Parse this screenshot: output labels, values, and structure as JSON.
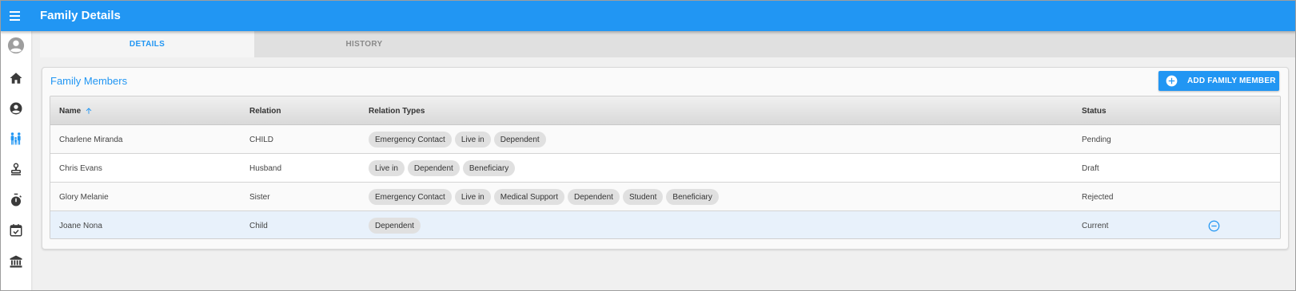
{
  "app": {
    "title": "Family Details"
  },
  "sidebar": {
    "items": [
      {
        "icon": "account-circle-icon"
      },
      {
        "icon": "home-icon"
      },
      {
        "icon": "account-icon"
      },
      {
        "icon": "family-icon",
        "active": true
      },
      {
        "icon": "stamp-icon"
      },
      {
        "icon": "timer-icon"
      },
      {
        "icon": "calendar-check-icon"
      },
      {
        "icon": "bank-icon"
      }
    ]
  },
  "tabs": [
    {
      "label": "DETAILS",
      "active": true
    },
    {
      "label": "HISTORY",
      "active": false
    }
  ],
  "card": {
    "title": "Family Members",
    "add_button_label": "ADD FAMILY MEMBER"
  },
  "table": {
    "columns": {
      "name": "Name",
      "relation": "Relation",
      "relation_types": "Relation Types",
      "status": "Status"
    },
    "rows": [
      {
        "name": "Charlene Miranda",
        "relation": "CHILD",
        "types": [
          "Emergency Contact",
          "Live in",
          "Dependent"
        ],
        "status": "Pending"
      },
      {
        "name": "Chris Evans",
        "relation": "Husband",
        "types": [
          "Live in",
          "Dependent",
          "Beneficiary"
        ],
        "status": "Draft"
      },
      {
        "name": "Glory Melanie",
        "relation": "Sister",
        "types": [
          "Emergency Contact",
          "Live in",
          "Medical Support",
          "Dependent",
          "Student",
          "Beneficiary"
        ],
        "status": "Rejected"
      },
      {
        "name": "Joane Nona",
        "relation": "Child",
        "types": [
          "Dependent"
        ],
        "status": "Current"
      }
    ]
  },
  "colors": {
    "primary": "#2196f3",
    "sidebar_icon": "#3a3a3a",
    "chip_bg": "#e0e0e0"
  }
}
